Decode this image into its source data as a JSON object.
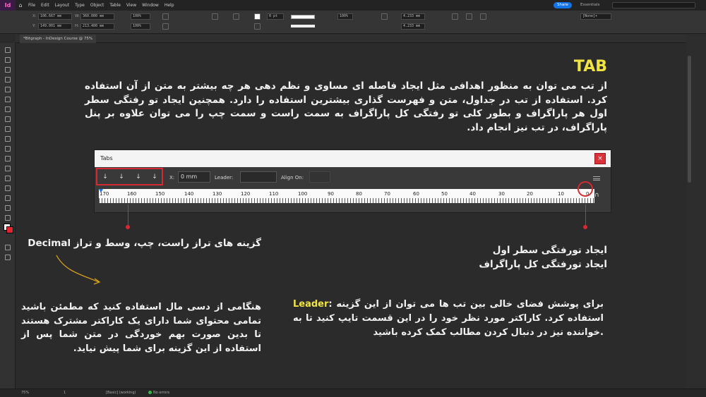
{
  "app": {
    "logo": "Id",
    "menu": [
      "File",
      "Edit",
      "Layout",
      "Type",
      "Object",
      "Table",
      "View",
      "Window",
      "Help"
    ],
    "share_label": "Share",
    "workspace": "Essentials",
    "document_tab": "*Bitgraph - InDesign Course @ 75%"
  },
  "control_bar": {
    "x_value": "106.667 mm",
    "y_value": "149.001 mm",
    "w_value": "360.000 mm",
    "h_value": "213.400 mm",
    "scale_x": "100%",
    "scale_y": "100%",
    "stroke_weight": "0 pt",
    "width_value": "4.233 mm",
    "height_value": "4.233 mm",
    "style_select": "[None]+"
  },
  "content": {
    "title": "TAB",
    "intro": "از تب می توان به منظور اهدافی مثل ایجاد فاصله ای مساوی و نظم دهی هر چه بیشتر به متن از آن استفاده کرد. استفاده از تب در جداول، متن و فهرست گذاری بیشترین استفاده را دارد. همچنین ایجاد تو رفتگی سطر اول هر پاراگراف و بطور کلی تو رفتگی کل پاراگراف به سمت راست و سمت چپ را می توان علاوه بر پنل پاراگراف، در تب نیز انجام داد.",
    "align_label_fa": "گزینه های تراز راست، چپ، وسط و تراز",
    "align_label_en": "Decimal",
    "indent_line1": "ایجاد تورفتگی سطر اول",
    "indent_line2": "ایجاد تورفتگی کل پاراگراف",
    "decimal_note": "هنگامی از دسی مال استفاده کنید که مطمئن باشید تمامی محتوای شما دارای یک کاراکتر مشترک هستند تا بدین صورت بهم خوردگی در متن شما پس از استفاده از این گزینه برای شما پیش نیاید.",
    "leader_keyword": "Leader",
    "leader_note": ": برای پوشش فضای خالی بین تب ها می توان از این گزینه استفاده کرد. کاراکتر مورد نظر خود را در این قسمت تایپ کنید تا به خواننده نیز در دنبال کردن مطالب کمک کرده باشید."
  },
  "tabs_panel": {
    "title": "Tabs",
    "close": "×",
    "x_label": "X:",
    "x_value": "0 mm",
    "leader_label": "Leader:",
    "leader_value": "",
    "align_on_label": "Align On:",
    "align_on_value": "",
    "align_buttons": [
      "↓",
      "↓",
      "↓",
      "↓"
    ],
    "ruler_numbers": [
      "170",
      "160",
      "150",
      "140",
      "130",
      "120",
      "110",
      "100",
      "90",
      "80",
      "70",
      "60",
      "50",
      "40",
      "30",
      "20",
      "10",
      "0"
    ]
  },
  "status": {
    "zoom": "75%",
    "page": "1",
    "preflight_profile": "[Basic] (working)",
    "errors": "No errors"
  },
  "colors": {
    "accent_yellow": "#f0e442",
    "highlight_red": "#d52a33",
    "share_blue": "#1473e6"
  }
}
